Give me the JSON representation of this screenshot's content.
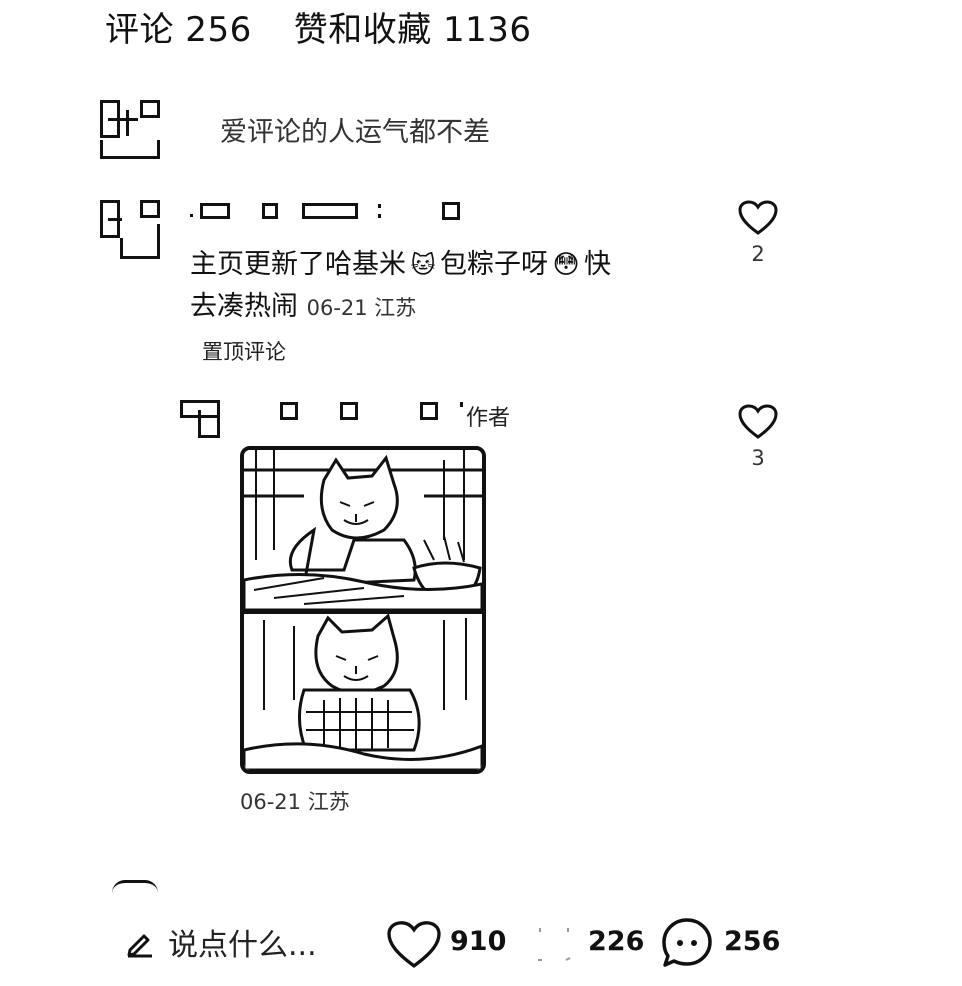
{
  "header": {
    "comments_label": "评论 256",
    "likes_label": "赞和收藏 1136"
  },
  "prompt": {
    "text": "爱评论的人运气都不差"
  },
  "comment": {
    "text_line1": "主页更新了哈基米",
    "text_line1b": "包粽子呀",
    "text_line1c": "快",
    "text_line2": "去凑热闹",
    "meta": "06-21 江苏",
    "pinned_label": "置顶评论",
    "like_count": "2"
  },
  "reply": {
    "author_tag": "作者",
    "meta": "06-21 江苏",
    "like_count": "3"
  },
  "bottom_bar": {
    "input_placeholder": "说点什么...",
    "like_count": "910",
    "collect_count": "226",
    "comment_count": "256"
  },
  "icons": {
    "edit": "pencil-icon",
    "heart": "heart-icon",
    "star": "star-icon",
    "comment": "comment-bubble-icon"
  }
}
